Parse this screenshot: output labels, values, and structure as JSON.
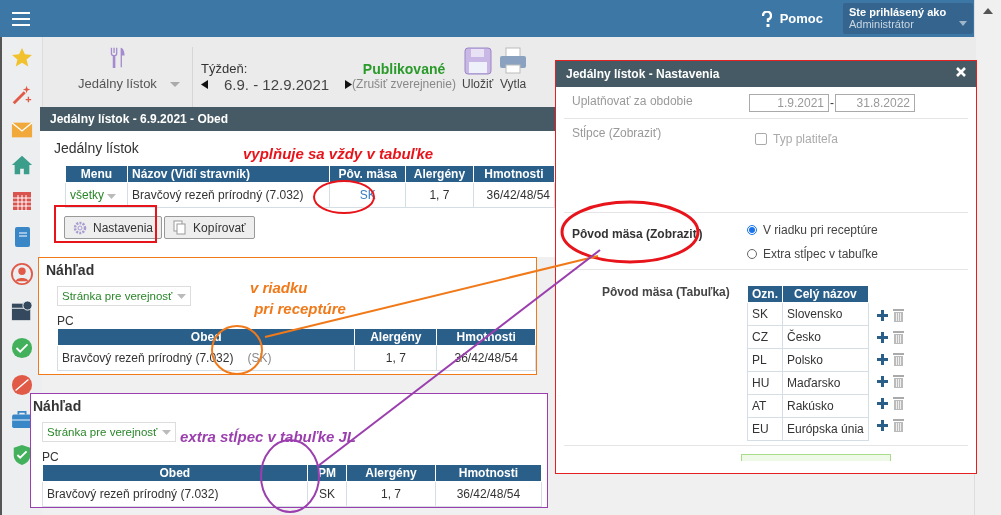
{
  "topbar": {
    "help": "Pomoc",
    "user_label": "Ste prihlásený ako",
    "user_value": "Administrátor"
  },
  "toolbar": {
    "module": "Jedálny lístok",
    "week_label": "Týždeň:",
    "week": "6.9. - 12.9.2021",
    "status": "Publikované",
    "status_action": "(Zrušiť zverejnenie)",
    "save": "Uložiť",
    "print": "Vytla"
  },
  "editor": {
    "title": "Jedálny lístok - 6.9.2021 - Obed",
    "heading": "Jedálny lístok",
    "columns": [
      "Menu",
      "Názov (Vidí stravník)",
      "Pôv. mäsa",
      "Alergény",
      "Hmotnosti"
    ],
    "rows": [
      {
        "menu": "všetky",
        "name": "Bravčový rezeň prírodný (7.032)",
        "origin": "SK",
        "allergens": "1, 7",
        "weights": "36/42/48/54"
      }
    ],
    "buttons": [
      {
        "kind": "settings",
        "label": "Nastavenia"
      },
      {
        "kind": "copy",
        "label": "Kopírovať"
      }
    ]
  },
  "previews": [
    {
      "title": "Náhľad",
      "select": "Stránka pre verejnosť",
      "group": "PC",
      "columns": [
        "Obed",
        "Alergény",
        "Hmotnosti"
      ],
      "rows": [
        {
          "cells": [
            {
              "text": "Bravčový rezeň prírodný (7.032)",
              "note": "(SK)"
            },
            {
              "text": "1, 7"
            },
            {
              "text": "36/42/48/54"
            }
          ]
        }
      ]
    },
    {
      "title": "Náhľad",
      "select": "Stránka pre verejnosť",
      "group": "PC",
      "columns": [
        "Obed",
        "PM",
        "Alergény",
        "Hmotnosti"
      ],
      "rows": [
        {
          "cells": [
            {
              "text": "Bravčový rezeň prírodný (7.032)"
            },
            {
              "text": "SK"
            },
            {
              "text": "1, 7"
            },
            {
              "text": "36/42/48/54"
            }
          ]
        }
      ]
    }
  ],
  "annotations": [
    {
      "text": "vyplňuje sa vždy v tabuľke",
      "color": "#e8141b"
    },
    {
      "text": "v riadku\n pri receptúre",
      "color": "#f07a1a"
    },
    {
      "text": "extra stĺpec v tabuľke JL",
      "color": "#9b3fae"
    }
  ],
  "dialog": {
    "title": "Jedálny lístok - Nastavenia",
    "period_label": "Uplatňovať za obdobie",
    "period_from": "1.9.2021",
    "period_separator": "-",
    "period_to": "31.8.2022",
    "columns_label": "Stĺpce (Zobraziť)",
    "column_options": [
      {
        "label": "Typ platiteľa",
        "checked": false
      }
    ],
    "origin_label": "Pôvod mäsa (Zobraziť)",
    "origin_options": [
      {
        "label": "V riadku pri receptúre",
        "selected": true
      },
      {
        "label": "Extra stĺpec v tabuľke",
        "selected": false
      }
    ],
    "table_label": "Pôvod mäsa (Tabuľka)",
    "table_columns": [
      "Ozn.",
      "Celý názov"
    ],
    "origins": [
      {
        "code": "SK",
        "name": "Slovensko"
      },
      {
        "code": "CZ",
        "name": "Česko"
      },
      {
        "code": "PL",
        "name": "Polsko"
      },
      {
        "code": "HU",
        "name": "Maďarsko"
      },
      {
        "code": "AT",
        "name": "Rakúsko"
      },
      {
        "code": "EU",
        "name": "Európska únia"
      }
    ]
  }
}
